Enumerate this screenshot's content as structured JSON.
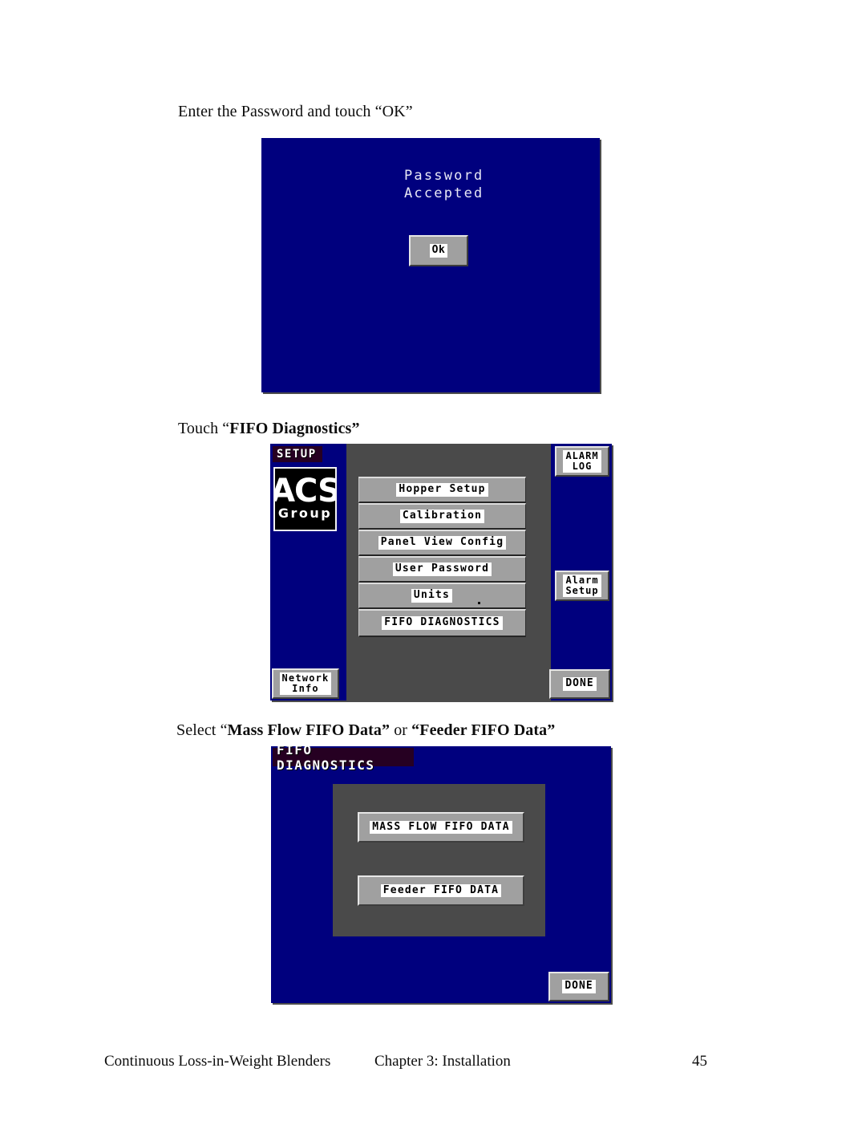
{
  "page": {
    "instruction_1": "Enter the Password and touch “OK”",
    "instruction_2_prefix": "Touch “",
    "instruction_2_bold": "FIFO Diagnostics”",
    "instruction_3_prefix": "Select “",
    "instruction_3_bold_a": "Mass Flow FIFO Data”",
    "instruction_3_mid": " or ",
    "instruction_3_bold_b": "“Feeder FIFO Data”"
  },
  "colors": {
    "screen_blue": "#00007e",
    "panel_gray": "#4a4a4a",
    "button_gray": "#a0a0a0",
    "title_badge": "#260022",
    "plate_white": "#ffffff",
    "text_black": "#000000"
  },
  "screen_password": {
    "message_line_1": "Password",
    "message_line_2": "Accepted",
    "ok_button": "Ok"
  },
  "screen_setup": {
    "title": "SETUP",
    "logo_top": "ACS",
    "logo_bottom": "Group",
    "menu_items": [
      {
        "label": "Hopper Setup"
      },
      {
        "label": "Calibration"
      },
      {
        "label": "Panel View Config"
      },
      {
        "label": "User Password"
      },
      {
        "label": "Units"
      },
      {
        "label": "FIFO DIAGNOSTICS"
      }
    ],
    "left_bottom_button": "Network\nInfo",
    "right_buttons": [
      {
        "label": "ALARM\nLOG"
      },
      {
        "label": "Alarm\nSetup"
      },
      {
        "label": "DONE"
      }
    ]
  },
  "screen_fifo": {
    "title": "FIFO DIAGNOSTICS",
    "buttons": [
      {
        "label": "MASS FLOW FIFO DATA"
      },
      {
        "label": "Feeder FIFO DATA"
      }
    ],
    "done_button": "DONE"
  },
  "footer": {
    "left": "Continuous Loss-in-Weight Blenders",
    "center": "Chapter 3: Installation",
    "page_number": "45"
  }
}
